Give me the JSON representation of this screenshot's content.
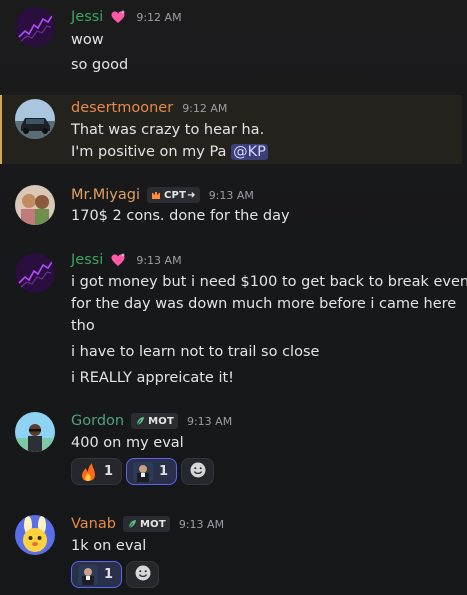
{
  "colors": {
    "jessi": "#3ba55c",
    "desertmooner": "#e68a4c",
    "mrmiyagi": "#e0a060",
    "gordon": "#4fa37a",
    "vanab": "#e68a4c",
    "highlight_bar": "#d4a84a",
    "mention_bg": "#3b3f77"
  },
  "messages": [
    {
      "username": "Jessi",
      "time": "9:12 AM",
      "badge_icon": "heart-sparkle-icon",
      "lines": [
        "wow",
        "so good"
      ]
    },
    {
      "username": "desertmooner",
      "time": "9:12 AM",
      "highlighted": true,
      "line1": "That was crazy to hear ha.",
      "line2_text": "I'm positive on my Pa ",
      "mention": "@KP"
    },
    {
      "username": "Mr.Miyagi",
      "time": "9:13 AM",
      "tag": "CPT",
      "tag_icon": "castle-icon",
      "lines": [
        "170$ 2 cons. done for the day"
      ]
    },
    {
      "username": "Jessi",
      "time": "9:13 AM",
      "badge_icon": "heart-sparkle-icon",
      "lines": [
        "i got money but i need $100 to get back to break even",
        "for the day was down much more before i came here",
        "tho",
        "i have to learn not to trail so close",
        "i REALLY appreicate it!"
      ]
    },
    {
      "username": "Gordon",
      "time": "9:13 AM",
      "tag": "MOT",
      "tag_icon": "leaf-icon",
      "lines": [
        "400 on my eval"
      ],
      "reactions": [
        {
          "emoji": "fire-icon",
          "count": "1"
        },
        {
          "emoji": "custom-emote-icon",
          "count": "1",
          "active": true
        }
      ]
    },
    {
      "username": "Vanab",
      "time": "9:13 AM",
      "tag": "MOT",
      "tag_icon": "leaf-icon",
      "lines": [
        "1k on eval"
      ],
      "reactions": [
        {
          "emoji": "custom-emote-icon",
          "count": "1",
          "active": true
        }
      ]
    }
  ]
}
